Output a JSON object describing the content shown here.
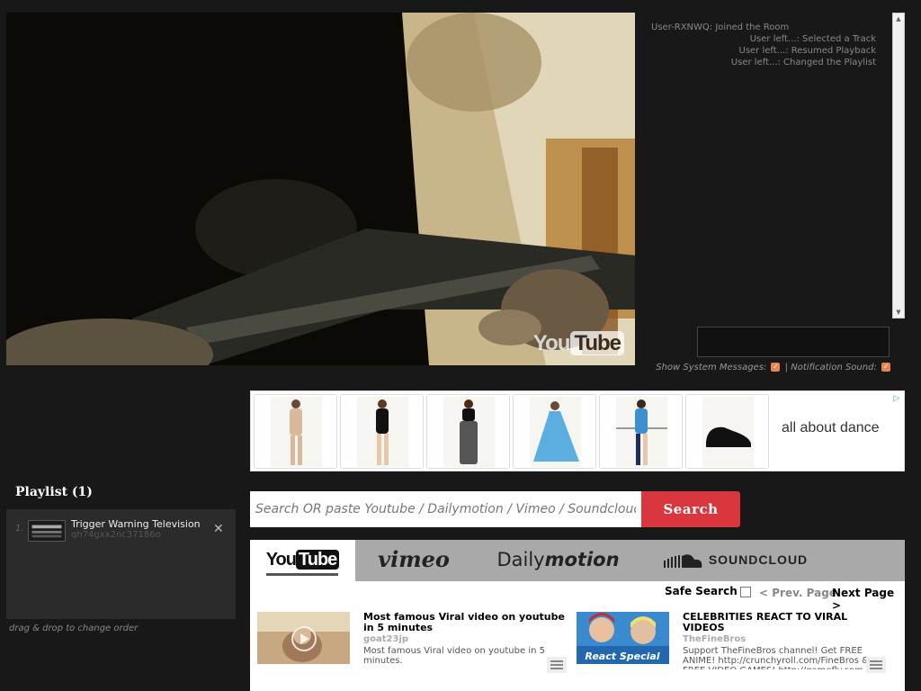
{
  "video": {
    "watermark_you": "You",
    "watermark_tube": "Tube"
  },
  "chat": {
    "messages": [
      "User-RXNWQ: Joined the Room",
      "User left...: Selected a Track",
      "User left...: Resumed Playback",
      "User left...: Changed the Playlist"
    ],
    "show_system_label": "Show System Messages:",
    "separator": "|",
    "notification_label": "Notification Sound:",
    "check_glyph": "✓"
  },
  "ad": {
    "brand": "all about dance",
    "choice_glyph": "▷"
  },
  "playlist": {
    "title": "Playlist (1)",
    "items": [
      {
        "num": "1.",
        "title": "Trigger Warning Television",
        "sub": "qh74gxx2nc37186o"
      }
    ],
    "remove_glyph": "✕",
    "hint": "drag & drop to change order"
  },
  "search": {
    "placeholder": "Search OR paste Youtube / Dailymotion / Vimeo / Soundcloud",
    "button": "Search"
  },
  "tabs": {
    "youtube_you": "You",
    "youtube_tube": "Tube",
    "vimeo": "vimeo",
    "daily_a": "Daily",
    "daily_b": "motion",
    "soundcloud": "SOUNDCLOUD"
  },
  "results": {
    "safe_search": "Safe Search",
    "prev": "< Prev. Page",
    "next": "Next Page >",
    "items": [
      {
        "title": "Most famous Viral video on youtube in 5 minutes",
        "channel": "goat23jp",
        "desc": "Most famous Viral video on youtube in 5 minutes."
      },
      {
        "title": "CELEBRITIES REACT TO VIRAL VIDEOS",
        "channel": "TheFineBros",
        "desc": "Support TheFineBros channel! Get FREE ANIME! http://crunchyroll.com/FineBros & FREE VIDEO GAMES! http://gamefly.com"
      }
    ],
    "thumb2_label": "React Special"
  }
}
